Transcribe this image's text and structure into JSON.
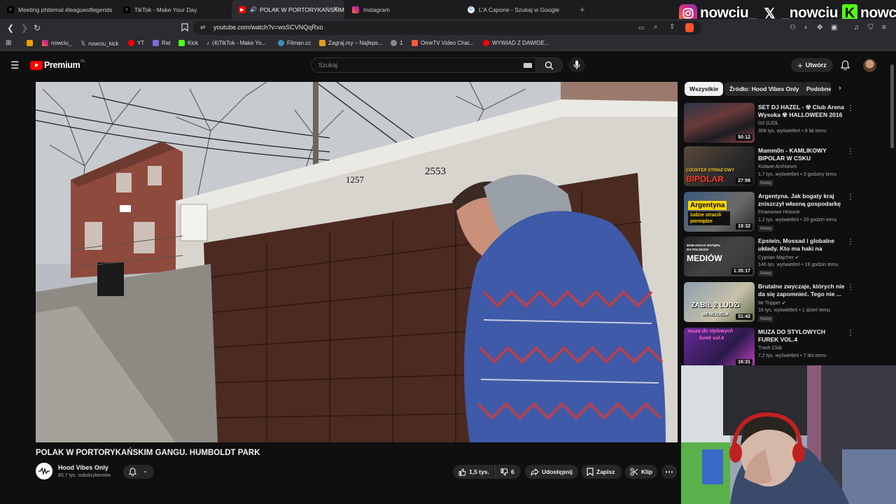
{
  "browser": {
    "tabs": [
      {
        "label": "Meeting phitemal #leagueoflegends",
        "icon": "tiktok-icon"
      },
      {
        "label": "TikTok - Make Your Day",
        "icon": "tiktok-icon"
      },
      {
        "label": "POLAK W PORTORYKAŃSKIM",
        "icon": "youtube-icon",
        "active": true
      },
      {
        "label": "Instagram",
        "icon": "instagram-icon"
      },
      {
        "label": "L'A Capone - Szukaj w Google",
        "icon": "google-icon"
      }
    ],
    "url": "youtube.com/watch?v=wsSCVNQqRxo",
    "bookmarks": [
      {
        "label": "",
        "color": "#e8a000"
      },
      {
        "label": "nowciu_",
        "color": "#d6249f"
      },
      {
        "label": "nowciu_kick",
        "color": "#000000"
      },
      {
        "label": "YT",
        "color": "#ff0000"
      },
      {
        "label": "Rat",
        "color": "#5865f2"
      },
      {
        "label": "Kick",
        "color": "#53fc18"
      },
      {
        "label": "(4)TikTok - Make Yo...",
        "color": "#222222"
      },
      {
        "label": "Filman.cc",
        "color": "#3c8dbc"
      },
      {
        "label": "Zagraj.my – Najleps...",
        "color": "#e0a020"
      },
      {
        "label": "1",
        "color": "#888888"
      },
      {
        "label": "OmeTV Video Chat...",
        "color": "#ff5a3c"
      },
      {
        "label": "WYWIAD Z DAWIDE...",
        "color": "#ff0000"
      }
    ]
  },
  "social": [
    {
      "platform": "instagram",
      "handle": "nowciu_"
    },
    {
      "platform": "x",
      "handle": "_nowciu"
    },
    {
      "platform": "kick",
      "handle": "nowciu"
    }
  ],
  "youtube": {
    "logo": "Premium",
    "logo_region": "PL",
    "search_placeholder": "Szukaj",
    "create_label": "Utwórz"
  },
  "video": {
    "title": "POLAK W PORTORYKAŃSKIM GANGU. HUMBOLDT PARK",
    "channel": "Hood Vibes Only",
    "subscribers": "85,7 tys. subskrybentów",
    "likes": "1,5 tys.",
    "dislikes": "6",
    "share_label": "Udostępnij",
    "save_label": "Zapisz",
    "clip_label": "Klip",
    "scene_numbers": [
      "1257",
      "2553"
    ]
  },
  "chips": [
    {
      "label": "Wszystkie",
      "selected": true
    },
    {
      "label": "Źródło: Hood Vibes Only"
    },
    {
      "label": "Podobne"
    }
  ],
  "recommendations": [
    {
      "title": "SET DJ HAZEL - ☢ Club Arena Wysoka ☢ HALLOWEEN 2016 ...",
      "channel": "G0 GJOL",
      "meta": "308 tys. wyświetleń • 9 lat temu",
      "duration": "50:12",
      "new": "",
      "thumb_text": "",
      "thumb_subtext": ""
    },
    {
      "title": "Mamm0n - KAMLIKOWY BIPOLAR W CSKU",
      "channel": "Kulawe Archiwum",
      "meta": "1,7 tys. wyświetleń • 3 godziny temu",
      "duration": "27:58",
      "new": "Nowy",
      "thumb_text": "COUNTER STRIKE'OWY",
      "thumb_subtext": "BIPOLAR"
    },
    {
      "title": "Argentyna. Jak bogaty kraj zniszczył własną gospodarkę",
      "channel": "Finansowe Historie",
      "meta": "1,2 tys. wyświetleń • 20 godzin temu",
      "duration": "19:32",
      "new": "Nowy",
      "thumb_text": "Argentyna",
      "thumb_subtext": "ludzie stracili pieniądze"
    },
    {
      "title": "Epstein, Mossad i globalne układy. Kto ma haki na polskie...",
      "channel": "Cyprian Majcher",
      "meta": "146 tys. wyświetleń • 19 godzin temu",
      "duration": "1:35:17",
      "new": "Nowy",
      "thumb_text": "MAM ZAKAZ WSTĘPU DO POLSKICH",
      "thumb_subtext": "MEDIÓW"
    },
    {
      "title": "Brutalne zwyczaje, których nie da się zapomnieć. Tego nie ...",
      "channel": "Mr Tripper",
      "meta": "16 tys. wyświetleń • 1 dzień temu",
      "duration": "31:42",
      "new": "Nowy",
      "thumb_text": "ZABIŁ 2 LUDZI",
      "thumb_subtext": "WENEZUELA"
    },
    {
      "title": "MUZA DO STYLOWYCH FUREK VOL.4",
      "channel": "Trash Club",
      "meta": "7,2 tys. wyświetleń • 7 dni temu",
      "duration": "16:31",
      "new": "",
      "thumb_text": "muza do stylowych",
      "thumb_subtext": "furek vol.4"
    }
  ],
  "colors": {
    "background": "#0f0f0f",
    "youtube_red": "#ff0000",
    "chip_bg": "#272727",
    "kick_green": "#53fc18"
  }
}
